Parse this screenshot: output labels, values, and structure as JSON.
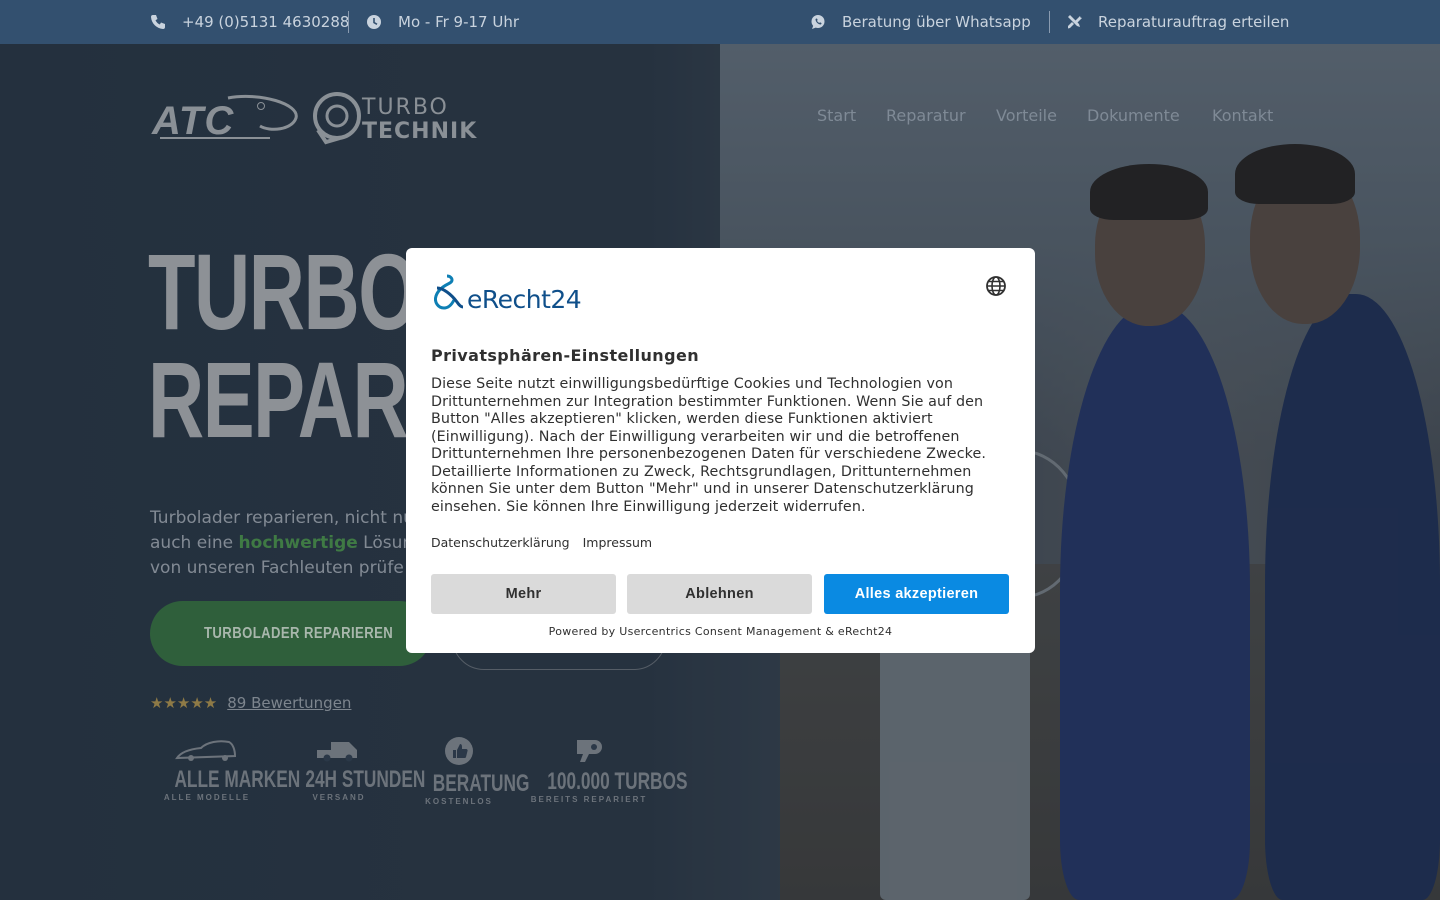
{
  "topbar": {
    "phone": "+49 (0)5131 4630288",
    "hours": "Mo - Fr 9-17 Uhr",
    "whatsapp": "Beratung über Whatsapp",
    "repair_order": "Reparaturauftrag erteilen"
  },
  "logo": {
    "brand_atc": "ATC",
    "brand_line1": "TURBO",
    "brand_line2": "TECHNIK"
  },
  "nav": {
    "items": [
      "Start",
      "Reparatur",
      "Vorteile",
      "Dokumente",
      "Kontakt"
    ]
  },
  "hero": {
    "headline_line1": "TURBOL",
    "headline_line2": "REPARI",
    "lead_line1": "Turbolader reparieren, nicht nu",
    "lead_line2_before": "auch eine ",
    "lead_line2_highlight": "hochwertige",
    "lead_line2_after": " Lösun",
    "lead_line3": "von unseren Fachleuten prüfe",
    "cta_primary": "TURBOLADER REPARIEREN",
    "stars": "★★★★★",
    "reviews": "89 Bewertungen"
  },
  "features": [
    {
      "title": "ALLE MARKEN",
      "subtitle": "ALLE MODELLE"
    },
    {
      "title": "24H STUNDEN",
      "subtitle": "VERSAND"
    },
    {
      "title": "BERATUNG",
      "subtitle": "KOSTENLOS"
    },
    {
      "title": "100.000 TURBOS",
      "subtitle": "BEREITS REPARIERT"
    }
  ],
  "consent": {
    "brand": "eRecht24",
    "title": "Privatsphären-Einstellungen",
    "body": "Diese Seite nutzt einwilligungsbedürftige Cookies und Technologien von Drittunternehmen zur Integration bestimmter Funktionen. Wenn Sie auf den Button \"Alles akzeptieren\" klicken, werden diese Funktionen aktiviert (Einwilligung). Nach der Einwilligung verarbeiten wir und die betroffenen Drittunternehmen Ihre personenbezogenen Daten für verschiedene Zwecke. Detaillierte Informationen zu Zweck, Rechtsgrundlagen, Drittunternehmen können Sie unter dem Button \"Mehr\" und in unserer Datenschutzerklärung einsehen. Sie können Ihre Einwilligung jederzeit widerrufen.",
    "link_privacy": "Datenschutzerklärung",
    "link_imprint": "Impressum",
    "btn_more": "Mehr",
    "btn_decline": "Ablehnen",
    "btn_accept": "Alles akzeptieren",
    "powered_by": "Powered by Usercentrics Consent Management & eRecht24"
  },
  "colors": {
    "topbar": "#33506f",
    "accent_green": "#2f5f3b",
    "accept_blue": "#0a8ae2",
    "brand_blue": "#0f4f8a"
  }
}
